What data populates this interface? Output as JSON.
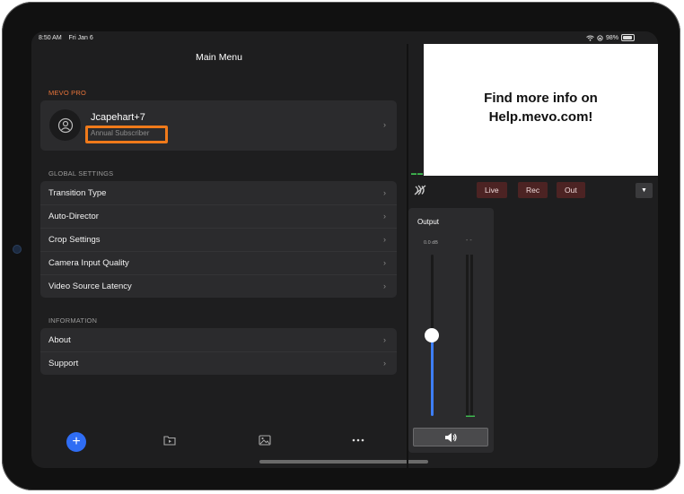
{
  "status_bar": {
    "time": "8:50 AM",
    "date": "Fri Jan 6",
    "battery": "98%"
  },
  "menu": {
    "title": "Main Menu",
    "pro_section": "MEVO PRO",
    "profile": {
      "name": "Jcapehart+7",
      "subscription": "Annual Subscriber"
    },
    "global_settings_label": "GLOBAL SETTINGS",
    "global_settings": [
      {
        "label": "Transition Type"
      },
      {
        "label": "Auto-Director"
      },
      {
        "label": "Crop Settings"
      },
      {
        "label": "Camera Input Quality"
      },
      {
        "label": "Video Source Latency"
      }
    ],
    "information_label": "INFORMATION",
    "information": [
      {
        "label": "About"
      },
      {
        "label": "Support"
      }
    ]
  },
  "toolbar": {
    "icons": [
      "plus-icon",
      "video-folder-icon",
      "image-icon",
      "more-icon"
    ]
  },
  "preview": {
    "text_line1": "Find more info on",
    "text_line2": "Help.mevo.com!"
  },
  "controls": {
    "live": "Live",
    "rec": "Rec",
    "out": "Out"
  },
  "output_panel": {
    "title": "Output",
    "gain": "0.0 dB",
    "volume_level": 0.5
  },
  "colors": {
    "accent": "#2f6df4",
    "highlight": "#f07a1a",
    "pro_label": "#e8743a",
    "tag_bg": "#4c2323"
  }
}
